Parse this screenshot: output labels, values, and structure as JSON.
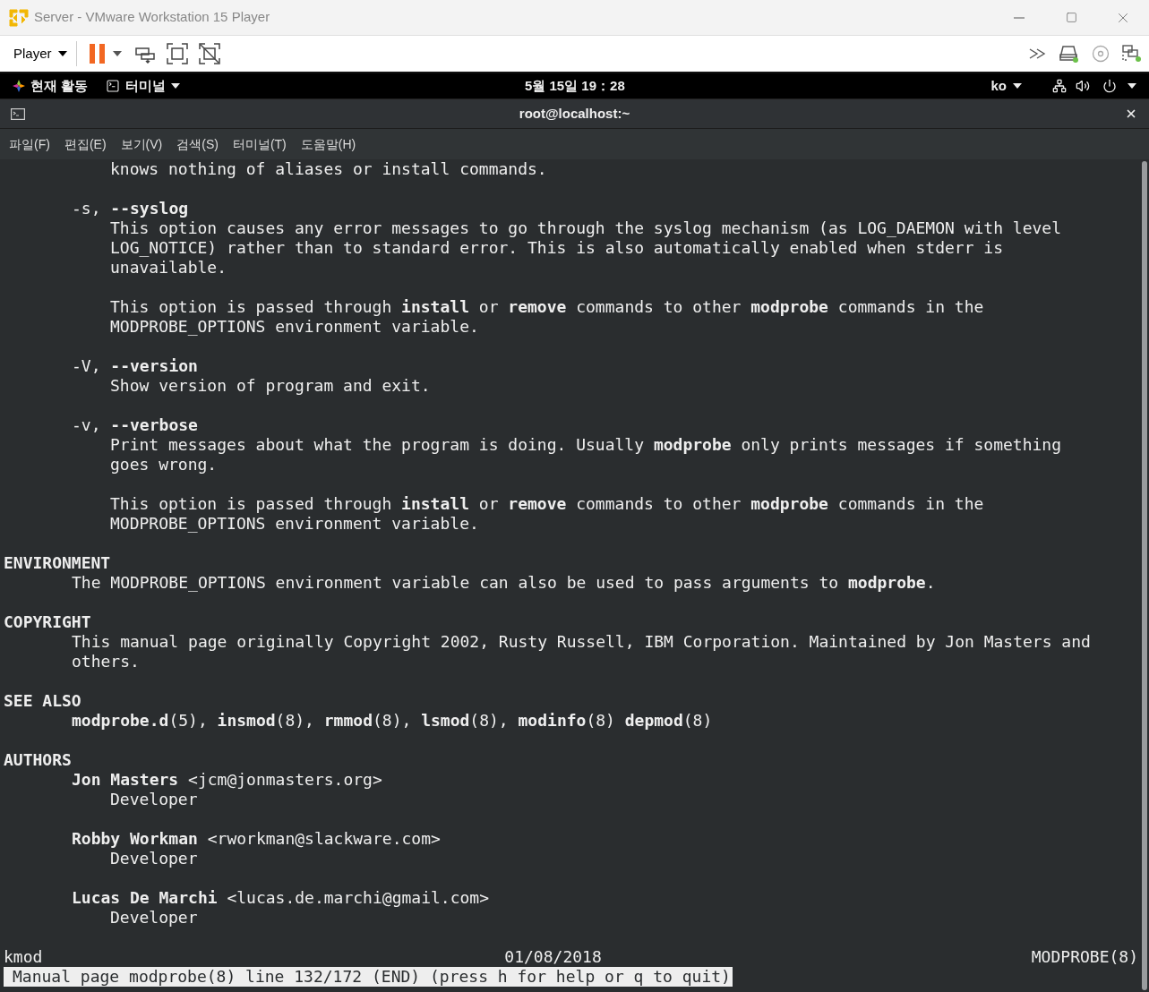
{
  "window": {
    "title": "Server - VMware Workstation 15 Player"
  },
  "toolbar": {
    "player_menu": "Player"
  },
  "top_bar": {
    "activities": "현재 활동",
    "app_menu": "터미널",
    "clock": "5월 15일 19：28",
    "input_method": "ko"
  },
  "terminal": {
    "title": "root@localhost:~",
    "menu": [
      "파일(F)",
      "편집(E)",
      "보기(V)",
      "검색(S)",
      "터미널(T)",
      "도움말(H)"
    ],
    "lines": [
      {
        "kind": "desc",
        "text": "knows nothing of aliases or install commands."
      },
      {
        "kind": "blank"
      },
      {
        "kind": "para",
        "text": "-s, **--syslog**"
      },
      {
        "kind": "desc",
        "text": "This option causes any error messages to go through the syslog mechanism (as LOG_DAEMON with level"
      },
      {
        "kind": "desc",
        "text": "LOG_NOTICE) rather than to standard error. This is also automatically enabled when stderr is"
      },
      {
        "kind": "desc",
        "text": "unavailable."
      },
      {
        "kind": "blank"
      },
      {
        "kind": "desc",
        "text": "This option is passed through **install** or **remove** commands to other **modprobe** commands in the"
      },
      {
        "kind": "desc",
        "text": "MODPROBE_OPTIONS environment variable."
      },
      {
        "kind": "blank"
      },
      {
        "kind": "para",
        "text": "-V, **--version**"
      },
      {
        "kind": "desc",
        "text": "Show version of program and exit."
      },
      {
        "kind": "blank"
      },
      {
        "kind": "para",
        "text": "-v, **--verbose**"
      },
      {
        "kind": "desc",
        "text": "Print messages about what the program is doing. Usually **modprobe** only prints messages if something"
      },
      {
        "kind": "desc",
        "text": "goes wrong."
      },
      {
        "kind": "blank"
      },
      {
        "kind": "desc",
        "text": "This option is passed through **install** or **remove** commands to other **modprobe** commands in the"
      },
      {
        "kind": "desc",
        "text": "MODPROBE_OPTIONS environment variable."
      },
      {
        "kind": "blank"
      },
      {
        "kind": "heading",
        "text": "ENVIRONMENT"
      },
      {
        "kind": "para",
        "text": "The MODPROBE_OPTIONS environment variable can also be used to pass arguments to **modprobe**."
      },
      {
        "kind": "blank"
      },
      {
        "kind": "heading",
        "text": "COPYRIGHT"
      },
      {
        "kind": "para",
        "text": "This manual page originally Copyright 2002, Rusty Russell, IBM Corporation. Maintained by Jon Masters and"
      },
      {
        "kind": "para",
        "text": "others."
      },
      {
        "kind": "blank"
      },
      {
        "kind": "heading",
        "text": "SEE ALSO"
      },
      {
        "kind": "para",
        "text": "**modprobe.d**(5), **insmod**(8), **rmmod**(8), **lsmod**(8), **modinfo**(8) **depmod**(8)"
      },
      {
        "kind": "blank"
      },
      {
        "kind": "heading",
        "text": "AUTHORS"
      },
      {
        "kind": "para",
        "text": "**Jon Masters** <jcm@jonmasters.org>"
      },
      {
        "kind": "desc",
        "text": "Developer"
      },
      {
        "kind": "blank"
      },
      {
        "kind": "para",
        "text": "**Robby Workman** <rworkman@slackware.com>"
      },
      {
        "kind": "desc",
        "text": "Developer"
      },
      {
        "kind": "blank"
      },
      {
        "kind": "para",
        "text": "**Lucas De Marchi** <lucas.de.marchi@gmail.com>"
      },
      {
        "kind": "desc",
        "text": "Developer"
      },
      {
        "kind": "blank"
      }
    ],
    "footer": {
      "left": "kmod",
      "center": "01/08/2018",
      "right": "MODPROBE(8)"
    },
    "status": "Manual page modprobe(8) line 132/172 (END) (press h for help or q to quit)"
  }
}
